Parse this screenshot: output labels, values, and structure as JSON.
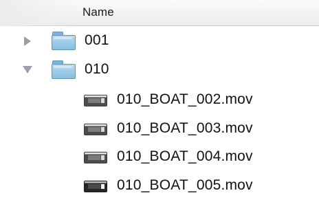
{
  "column_headers": {
    "name": "Name"
  },
  "items": [
    {
      "name": "001",
      "kind": "folder",
      "disclosure": "closed"
    },
    {
      "name": "010",
      "kind": "folder",
      "disclosure": "open"
    },
    {
      "name": "010_BOAT_002.mov",
      "kind": "movie-file"
    },
    {
      "name": "010_BOAT_003.mov",
      "kind": "movie-file"
    },
    {
      "name": "010_BOAT_004.mov",
      "kind": "movie-file"
    },
    {
      "name": "010_BOAT_005.mov",
      "kind": "movie-file"
    }
  ],
  "icons": {
    "disclosure_closed": "disclosure-triangle-right-icon",
    "disclosure_open": "disclosure-triangle-down-icon",
    "folder": "folder-icon",
    "movie_file": "movie-file-icon"
  },
  "colors": {
    "folder_blue": "#86bde2",
    "disclosure_gray": "#9aa0a6"
  }
}
